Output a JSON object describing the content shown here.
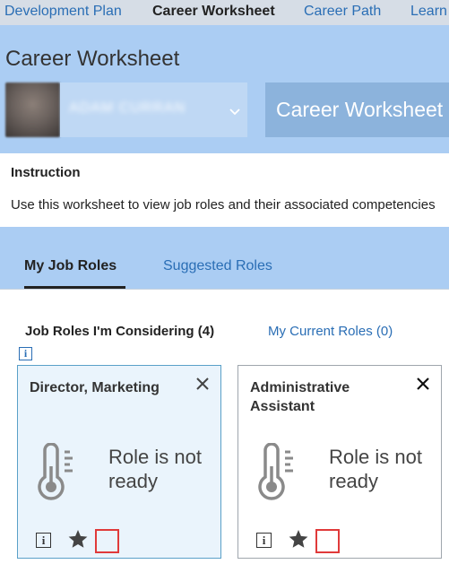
{
  "nav": {
    "tabs": [
      {
        "label": "Development Plan"
      },
      {
        "label": "Career Worksheet"
      },
      {
        "label": "Career Path"
      },
      {
        "label": "Learn"
      }
    ],
    "active": "Career Worksheet"
  },
  "header": {
    "title": "Career Worksheet",
    "user_name": "ADAM CURRAN",
    "worksheet_button": "Career Worksheet"
  },
  "instruction": {
    "title": "Instruction",
    "text": "Use this worksheet to view job roles and their associated competencies"
  },
  "subtabs": [
    {
      "label": "My Job Roles"
    },
    {
      "label": "Suggested Roles"
    }
  ],
  "roles": {
    "considering_label": "Job Roles I'm Considering (4)",
    "current_label": "My Current Roles (0)",
    "cards": [
      {
        "title": "Director, Marketing",
        "status": "Role is not ready"
      },
      {
        "title": "Administrative Assistant",
        "status": "Role is not ready"
      }
    ]
  },
  "icons": {
    "info_glyph": "i",
    "close_glyph": "×"
  },
  "colors": {
    "header_bg": "#abcdf3",
    "link": "#2a6eb5",
    "highlight": "#e03a3a"
  }
}
